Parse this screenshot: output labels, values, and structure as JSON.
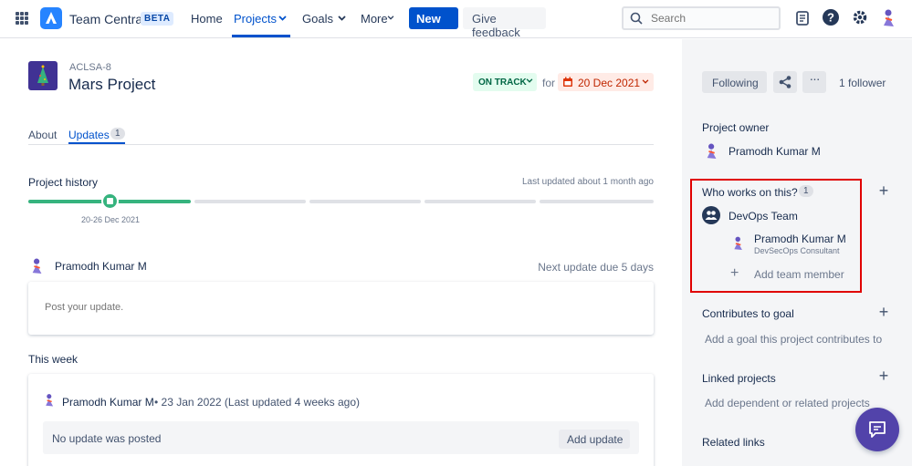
{
  "nav": {
    "brand": "Team Central",
    "beta": "BETA",
    "home": "Home",
    "projects": "Projects",
    "goals": "Goals",
    "more": "More",
    "new_button": "New",
    "feedback_button": "Give feedback",
    "search_placeholder": "Search"
  },
  "project": {
    "key": "ACLSA-8",
    "title": "Mars Project",
    "status": "ON TRACK",
    "for_label": "for",
    "target_date": "20 Dec 2021"
  },
  "tabs": {
    "about": "About",
    "updates": "Updates",
    "updates_count": "1"
  },
  "history": {
    "label": "Project history",
    "last_updated": "Last updated about 1 month ago",
    "period": "20-26 Dec 2021"
  },
  "update_composer": {
    "user": "Pramodh Kumar M",
    "next_due": "Next update due 5 days",
    "placeholder": "Post your update."
  },
  "this_week": {
    "label": "This week",
    "user": "Pramodh Kumar M",
    "meta": "• 23 Jan 2022 (Last updated 4 weeks ago)",
    "empty_text": "No update was posted",
    "add_button": "Add update"
  },
  "sidebar": {
    "following_button": "Following",
    "followers": "1 follower",
    "more_button": "···",
    "owner_heading": "Project owner",
    "owner_name": "Pramodh Kumar M",
    "who_heading": "Who works on this?",
    "who_count": "1",
    "team_name": "DevOps Team",
    "member_name": "Pramodh Kumar M",
    "member_role": "DevSecOps Consultant",
    "add_member": "Add team member",
    "goal_heading": "Contributes to goal",
    "goal_placeholder": "Add a goal this project contributes to",
    "linked_heading": "Linked projects",
    "linked_placeholder": "Add dependent or related projects",
    "links_heading": "Related links",
    "plus": "+"
  },
  "colors": {
    "primary": "#0052cc",
    "on_track_bg": "#e3fcef",
    "on_track_text": "#006644",
    "due_bg": "#ffebe6",
    "due_text": "#bf2600",
    "progress": "#36b37e",
    "highlight": "#e00000",
    "chat_fab": "#5243aa"
  },
  "icons": [
    "app-switcher-icon",
    "team-central-logo-icon",
    "search-icon",
    "notifications-icon",
    "help-icon",
    "settings-icon",
    "user-avatar-icon",
    "calendar-icon",
    "share-icon",
    "team-icon",
    "chat-icon"
  ]
}
